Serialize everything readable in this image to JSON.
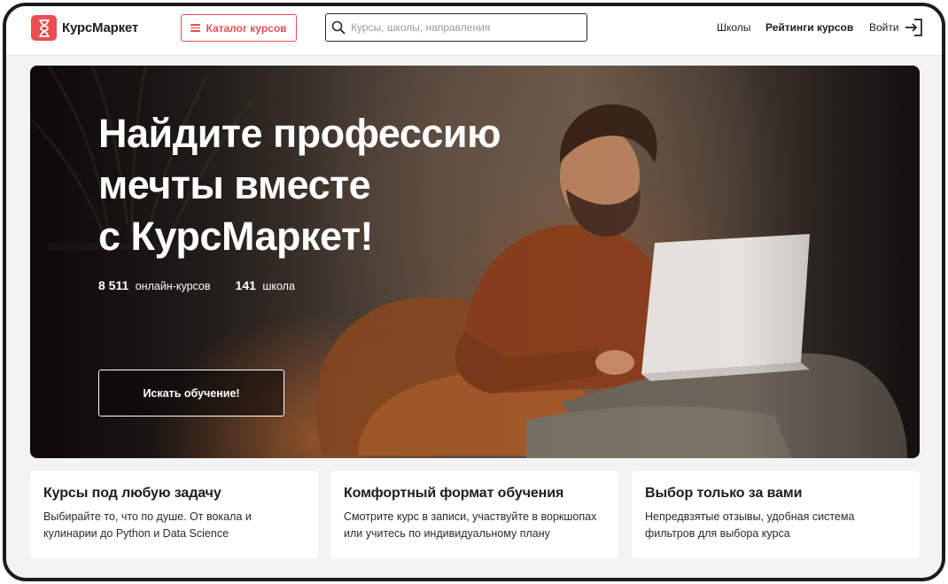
{
  "header": {
    "brand": "КурсМаркет",
    "catalog_label": "Каталог курсов",
    "search_placeholder": "Курсы, школы, направления",
    "nav": {
      "schools": "Школы",
      "ratings": "Рейтинги курсов",
      "login": "Войти"
    }
  },
  "hero": {
    "title_lines": [
      "Найдите профессию",
      "мечты вместе",
      "с КурсМаркет!"
    ],
    "stats": [
      {
        "value": "8 511",
        "label": "онлайн-курсов"
      },
      {
        "value": "141",
        "label": "школа"
      }
    ],
    "cta_label": "Искать обучение!"
  },
  "features": [
    {
      "title": "Курсы под любую задачу",
      "text": "Выбирайте то, что по душе. От вокала и кулинарии до Python и Data Science"
    },
    {
      "title": "Комфортный формат обучения",
      "text": "Смотрите курс в записи, участвуйте в воркшопах или учитесь по индивидуальному плану"
    },
    {
      "title": "Выбор только за вами",
      "text": "Непредвзятые отзывы, удобная система фильтров для выбора курса"
    }
  ],
  "colors": {
    "brand": "#e94e52",
    "text": "#1d1d1f",
    "page_bg": "#f3f3f4"
  },
  "icons": [
    "logo-mark-icon",
    "menu-icon",
    "search-icon",
    "login-icon"
  ]
}
